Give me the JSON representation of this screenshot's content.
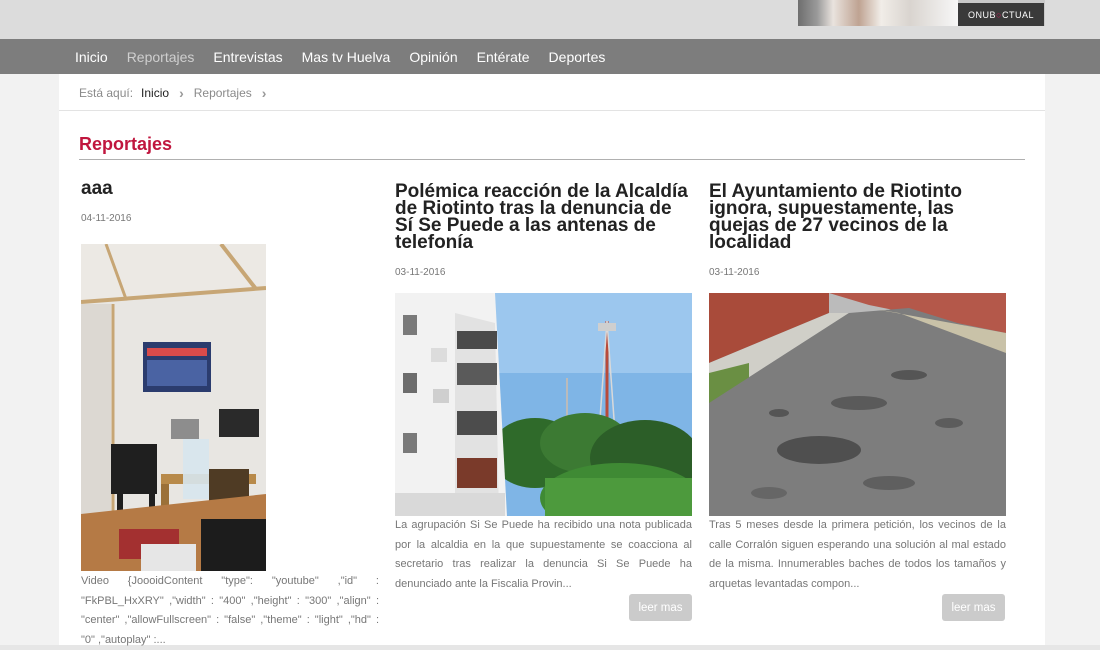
{
  "banner": {
    "logo_text_a": "ONUB",
    "logo_text_b": "CTUAL"
  },
  "nav": {
    "items": [
      "Inicio",
      "Reportajes",
      "Entrevistas",
      "Mas tv Huelva",
      "Opinión",
      "Entérate",
      "Deportes"
    ],
    "active_index": 1
  },
  "breadcrumb": {
    "prefix": "Está aquí:",
    "home": "Inicio",
    "current": "Reportajes"
  },
  "section": {
    "title": "Reportajes"
  },
  "articles": [
    {
      "title": "aaa",
      "date": "04-11-2016",
      "excerpt": "Video {JoooidContent \"type\": \"youtube\" ,\"id\" : \"FkPBL_HxXRY\" ,\"width\" : \"400\" ,\"height\" : \"300\" ,\"align\" : \"center\" ,\"allowFullscreen\" : \"false\" ,\"theme\" : \"light\" ,\"hd\" : \"0\" ,\"autoplay\" :..."
    },
    {
      "title": "Polémica reacción de la Alcaldía de Riotinto tras la denuncia de Sí Se Puede a las antenas de telefonía",
      "date": "03-11-2016",
      "excerpt": "La agrupación Si Se Puede ha recibido una nota publicada por la alcaldia en la que supuestamente se coacciona al secretario tras realizar la denuncia Si Se Puede ha denunciado ante la Fiscalia Provin...",
      "more": "leer mas"
    },
    {
      "title": "El Ayuntamiento de Riotinto ignora, supuestamente, las quejas de 27 vecinos de la localidad",
      "date": "03-11-2016",
      "excerpt": "Tras 5 meses desde la primera petición, los vecinos de la calle Corralón siguen esperando una solución al mal estado de la misma. Innumerables baches de todos los tamaños y arquetas levantadas compon...",
      "more": "leer mas"
    }
  ]
}
